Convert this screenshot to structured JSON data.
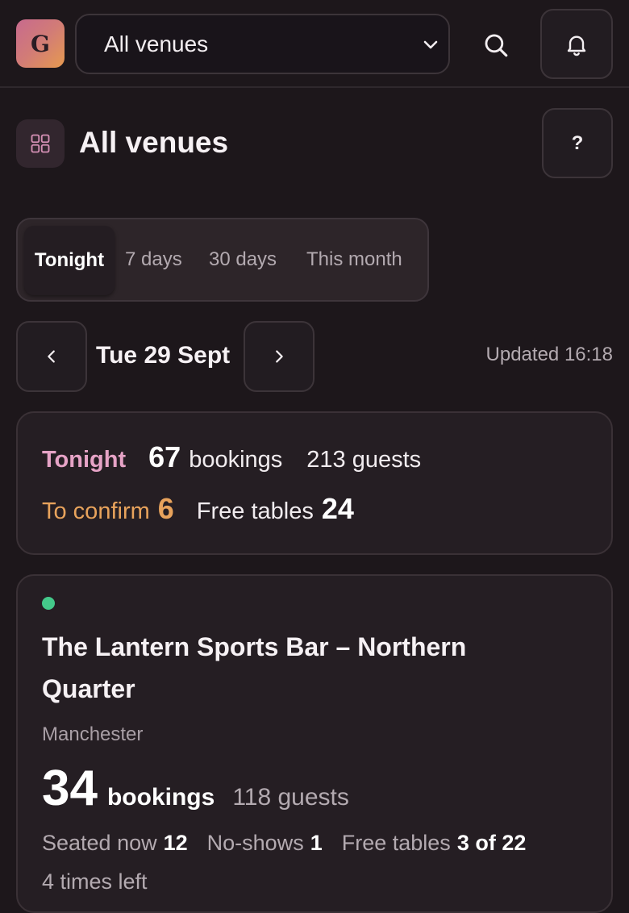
{
  "header": {
    "logo_letter": "G",
    "venue_select_value": "All venues",
    "icons": [
      "chevron-down-icon",
      "search-icon",
      "bell-icon"
    ]
  },
  "page": {
    "title": "All venues",
    "help_label": "?",
    "icon": "grid-icon"
  },
  "range_tabs": [
    {
      "label": "Tonight",
      "active": true
    },
    {
      "label": "7 days",
      "active": false
    },
    {
      "label": "30 days",
      "active": false
    },
    {
      "label": "This month",
      "active": false
    }
  ],
  "date_nav": {
    "date_label": "Tue 29 Sept",
    "updated_label": "Updated 16:18"
  },
  "summary": {
    "period_label": "Tonight",
    "bookings_value": "67",
    "bookings_label": "bookings",
    "guests_label": "213 guests",
    "to_confirm_label": "To confirm",
    "to_confirm_value": "6",
    "free_tables_label": "Free tables",
    "free_tables_value": "24"
  },
  "venues": [
    {
      "status_color": "#44c98a",
      "name": "The Lantern Sports Bar – Northern Quarter",
      "city": "Manchester",
      "bookings_value": "34",
      "bookings_label": "bookings",
      "guests_label": "118 guests",
      "seated_label": "Seated now",
      "seated_value": "12",
      "noshows_label": "No-shows",
      "noshows_value": "1",
      "free_tables_label": "Free tables",
      "free_tables_value": "3 of 22",
      "times_left_label": "4 times left"
    }
  ],
  "colors": {
    "background": "#1d171b",
    "card": "#251e23",
    "accent_pink": "#e6a3c6",
    "accent_orange": "#e8a35c",
    "status_green": "#44c98a"
  }
}
